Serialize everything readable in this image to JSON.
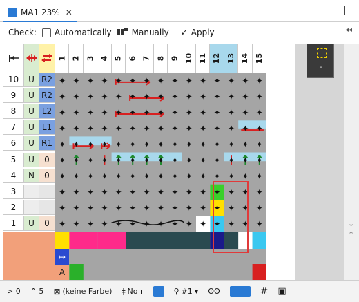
{
  "tab": {
    "title": "MA1 23%",
    "close": "✕"
  },
  "toolbar": {
    "check_label": "Check:",
    "auto_label": "Automatically",
    "manual_label": "Manually",
    "apply_label": "Apply",
    "apply_icon": "✓"
  },
  "collapse_label": "◂◂",
  "header_cols": [
    "1",
    "2",
    "3",
    "4",
    "5",
    "6",
    "7",
    "8",
    "9",
    "10",
    "11",
    "12",
    "13",
    "14",
    "15"
  ],
  "rows": [
    {
      "num": "10",
      "mode": "U",
      "reg": "R2"
    },
    {
      "num": "9",
      "mode": "U",
      "reg": "R2"
    },
    {
      "num": "8",
      "mode": "U",
      "reg": "L2"
    },
    {
      "num": "7",
      "mode": "U",
      "reg": "L1"
    },
    {
      "num": "6",
      "mode": "U",
      "reg": "R1"
    },
    {
      "num": "5",
      "mode": "U",
      "reg": "0"
    },
    {
      "num": "4",
      "mode": "N",
      "reg": "0"
    },
    {
      "num": "3",
      "mode": "",
      "reg": ""
    },
    {
      "num": "2",
      "mode": "",
      "reg": ""
    },
    {
      "num": "1",
      "mode": "U",
      "reg": "0"
    }
  ],
  "star_glyph": "✦",
  "status": {
    "left1": "> 0",
    "left2": "^ 5",
    "color_label": "(keine Farbe)",
    "no_label": "No r",
    "hash_label": "#1"
  },
  "bottom_row_labels": {
    "a": "A",
    "arrow": "↦"
  },
  "colors": {
    "accent": "#2a7ad4",
    "grid_gray": "#a5a5a5",
    "header_green": "#d9ecd0",
    "header_yellow": "#fff2a8",
    "blue_cell": "#7aa0e0",
    "pink": "#ff2a8a",
    "teal_dark": "#2a4a50",
    "navy": "#1a1a8a",
    "salmon": "#f2a07a",
    "light_blue_band": "#a8d8ec",
    "highlight_red": "#e03a3a"
  }
}
